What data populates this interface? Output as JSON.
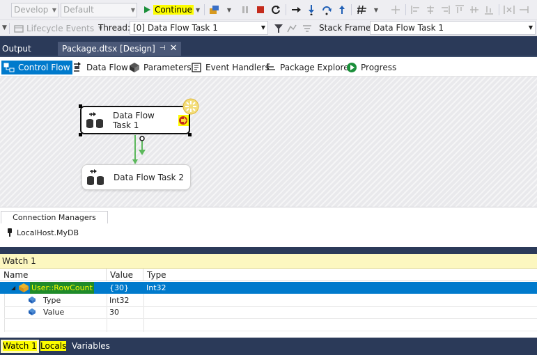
{
  "toolbar": {
    "solution_config": "Develop",
    "platform": "Default",
    "continue_label": "Continue"
  },
  "debug_location": {
    "lifecycle_events": "Lifecycle Events",
    "thread_label": "Thread:",
    "thread_value": "[0] Data Flow Task 1",
    "stack_frame_label": "Stack Frame:",
    "stack_frame_value": "Data Flow Task 1"
  },
  "doc_tabs": {
    "output": "Output",
    "package": "Package.dtsx [Design]"
  },
  "designer_tabs": [
    {
      "label": "Control Flow",
      "icon": "control-flow-icon",
      "active": true
    },
    {
      "label": "Data Flow",
      "icon": "data-flow-icon",
      "active": false
    },
    {
      "label": "Parameters",
      "icon": "parameters-icon",
      "active": false
    },
    {
      "label": "Event Handlers",
      "icon": "event-handlers-icon",
      "active": false
    },
    {
      "label": "Package Explorer",
      "icon": "package-explorer-icon",
      "active": false
    },
    {
      "label": "Progress",
      "icon": "progress-icon",
      "active": false
    }
  ],
  "canvas": {
    "task1": "Data Flow Task 1",
    "task2": "Data Flow Task 2"
  },
  "connection_managers": {
    "tab_label": "Connection Managers",
    "items": [
      "LocalHost.MyDB"
    ]
  },
  "watch": {
    "title": "Watch 1",
    "columns": [
      "Name",
      "Value",
      "Type"
    ],
    "rows": [
      {
        "name": "User::RowCount",
        "value": "{30}",
        "type": "Int32",
        "selected": true
      },
      {
        "name": "Type",
        "value": "Int32",
        "type": ""
      },
      {
        "name": "Value",
        "value": "30",
        "type": ""
      }
    ]
  },
  "bottom_tabs": [
    "Watch 1",
    "Locals",
    "Variables"
  ],
  "colors": {
    "accent": "#007acc",
    "tab_strip": "#2b3a59",
    "highlight": "#fdfd00",
    "watch_title_bg": "#fcf7c0",
    "stop_red": "#c42b1c",
    "continue_green": "#1b8f3a"
  }
}
